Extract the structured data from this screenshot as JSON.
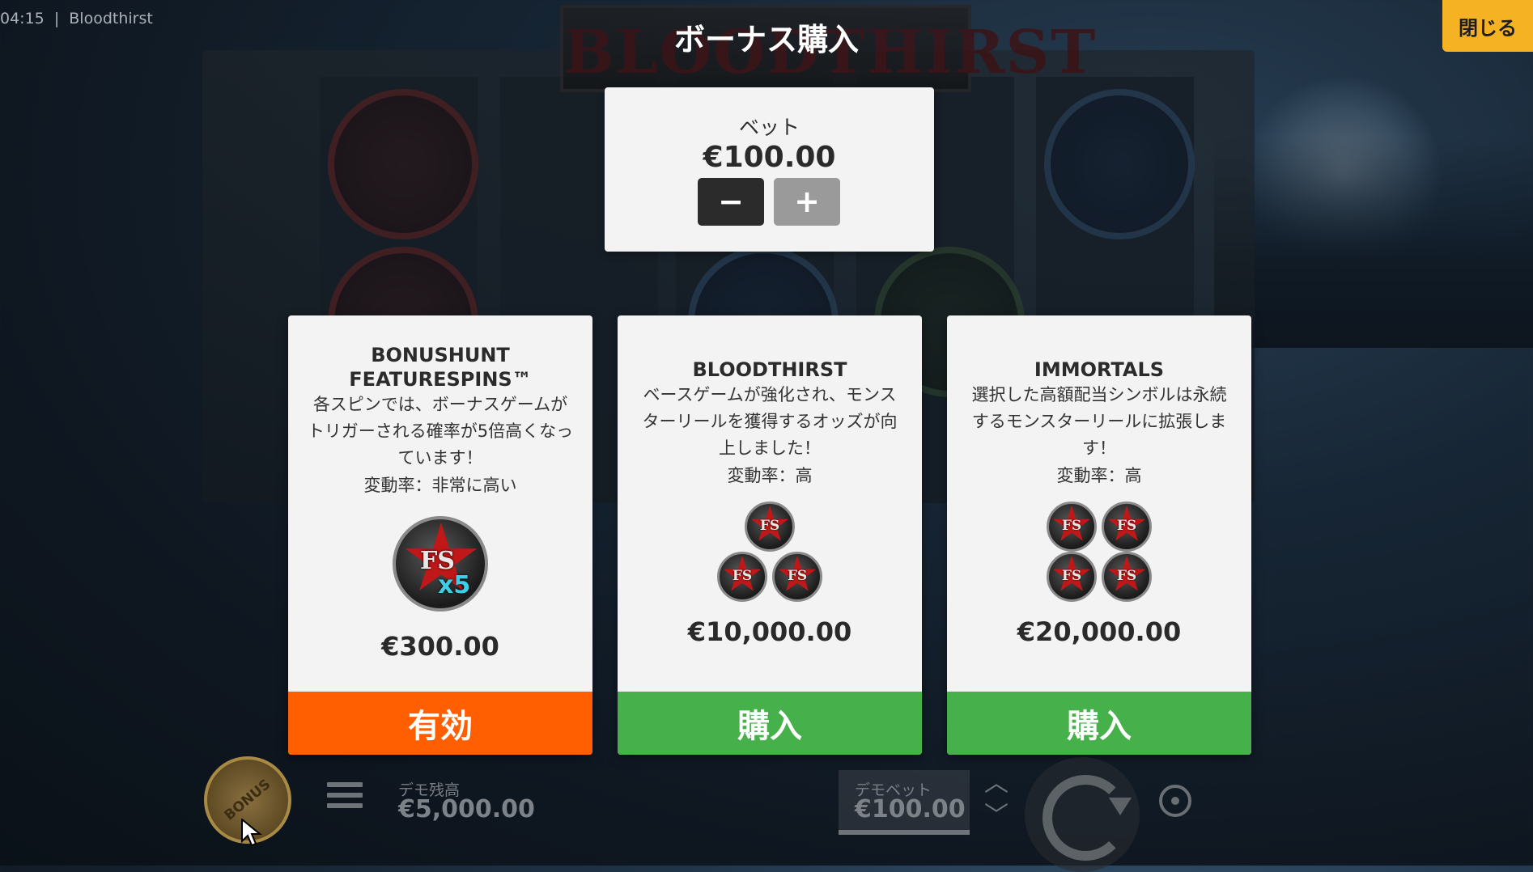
{
  "window": {
    "time": "04:15",
    "separator": "|",
    "game_name": "Bloodthirst"
  },
  "modal": {
    "title": "ボーナス購入",
    "close_label": "閉じる"
  },
  "bet": {
    "label": "ベット",
    "value": "€100.00",
    "minus_label": "−",
    "plus_label": "+"
  },
  "cards": [
    {
      "name_line1": "BONUSHUNT",
      "name_line2": "FEATURESPINS™",
      "desc_lines": [
        "各スピンでは、ボーナスゲームが",
        "トリガーされる確率が5倍高くなっ",
        "ています！"
      ],
      "volatility": "変動率：非常に高い",
      "icon_text": "FS",
      "icon_multiplier": "x5",
      "price": "€300.00",
      "action": "有効"
    },
    {
      "name": "BLOODTHIRST",
      "desc_lines": [
        "ベースゲームが強化され、モンス",
        "ターリールを獲得するオッズが向",
        "上しました！"
      ],
      "volatility": "変動率：高",
      "icon_text": "FS",
      "price": "€10,000.00",
      "action": "購入"
    },
    {
      "name": "IMMORTALS",
      "desc_lines": [
        "選択した高額配当シンボルは永続",
        "するモンスターリールに拡張しま",
        "す！"
      ],
      "volatility": "変動率：高",
      "icon_text": "FS",
      "price": "€20,000.00",
      "action": "購入"
    }
  ],
  "background": {
    "logo_text": "BLOODTHIRST"
  },
  "bottom_bar": {
    "bonus_label": "BONUS",
    "balance_label": "デモ残高",
    "balance_value": "€5,000.00",
    "bet_label": "デモベット",
    "bet_value": "€100.00"
  },
  "colors": {
    "close": "#f5b324",
    "active": "#ff5f00",
    "buy": "#46b04b"
  }
}
